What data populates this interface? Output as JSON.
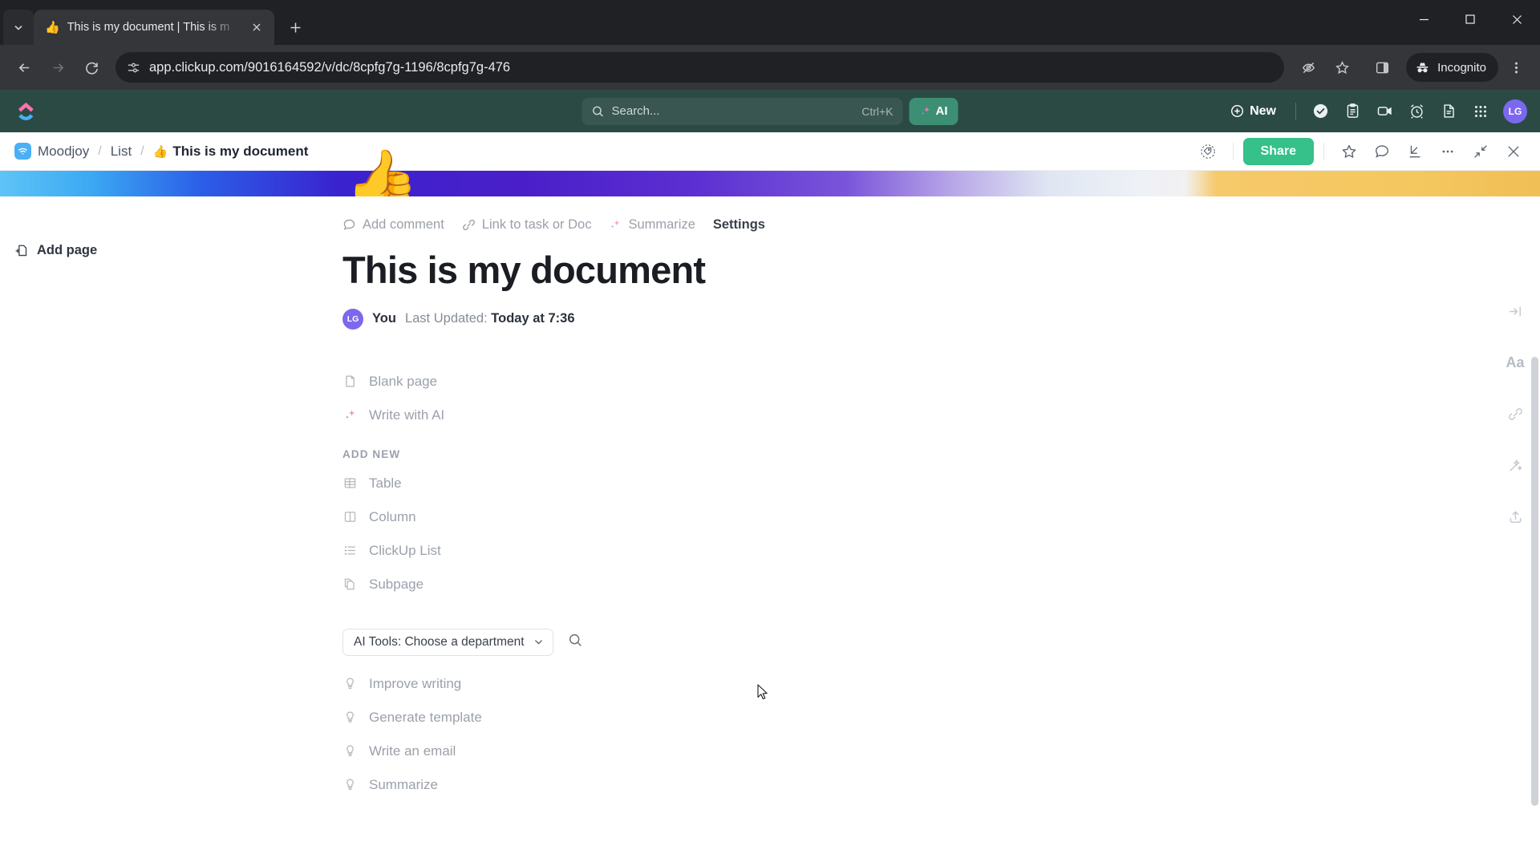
{
  "browser": {
    "tab": {
      "favicon": "thumbs-up-emoji",
      "title": "This is my document | This is m",
      "close_label": "×"
    },
    "new_tab_label": "+",
    "window_controls": {
      "minimize": "—",
      "maximize": "□",
      "close": "✕"
    },
    "nav": {
      "back": "back-arrow",
      "forward": "forward-arrow",
      "reload": "reload-arrow"
    },
    "omnibox": {
      "site_info_icon": "page-settings-icon",
      "url": "app.clickup.com/9016164592/v/dc/8cpfg7g-1196/8cpfg7g-476"
    },
    "toolbar_right": {
      "hide_icon": "eye-off-icon",
      "bookmark_icon": "star-icon",
      "sidepanel_icon": "side-panel-icon",
      "incognito_label": "Incognito",
      "menu_icon": "kebab-menu-icon"
    }
  },
  "app_header": {
    "logo": "clickup-logo",
    "search": {
      "icon": "search-icon",
      "placeholder": "Search...",
      "shortcut": "Ctrl+K"
    },
    "ai_button": {
      "label": "AI",
      "icon": "sparkle-icon",
      "color": "#3d8f74"
    },
    "new_button": {
      "label": "New",
      "icon": "plus-circle-icon"
    },
    "icons": [
      {
        "name": "check-circle-icon",
        "label": "Tasks"
      },
      {
        "name": "clipboard-icon",
        "label": "Notepad"
      },
      {
        "name": "video-camera-icon",
        "label": "Clip"
      },
      {
        "name": "alarm-clock-icon",
        "label": "Reminders"
      },
      {
        "name": "document-icon",
        "label": "Docs"
      },
      {
        "name": "apps-grid-icon",
        "label": "Apps"
      }
    ],
    "avatar": {
      "initials": "LG",
      "color": "#7b68ee"
    },
    "background": "#2b4a44"
  },
  "breadcrumb": {
    "space_icon": "wifi-space-icon",
    "space_color": "#4ab0f5",
    "items": [
      {
        "label": "Moodjoy",
        "current": false
      },
      {
        "label": "List",
        "current": false
      }
    ],
    "separator": "/",
    "current": {
      "emoji": "👍",
      "label": "This is my document"
    },
    "actions": {
      "tag_icon": "tag-icon",
      "share_label": "Share",
      "share_color": "#36c08a",
      "star_icon": "star-icon",
      "comment_icon": "comment-icon",
      "download_icon": "download-arrow-icon",
      "more_icon": "ellipsis-icon",
      "collapse_icon": "collapse-arrows-icon",
      "close_icon": "close-x-icon"
    }
  },
  "doc": {
    "banner_emoji": "👍",
    "actions": [
      {
        "label": "Add comment",
        "icon": "comment-icon",
        "muted": true
      },
      {
        "label": "Link to task or Doc",
        "icon": "link-icon",
        "muted": true
      },
      {
        "label": "Summarize",
        "icon": "sparkle-icon",
        "muted": true
      },
      {
        "label": "Settings",
        "icon": "",
        "muted": false
      }
    ],
    "title": "This is my document",
    "meta": {
      "avatar_initials": "LG",
      "author": "You",
      "updated_prefix": "Last Updated: ",
      "updated_value": "Today at 7:36"
    },
    "quick_options": [
      {
        "label": "Blank page",
        "icon": "page-icon"
      },
      {
        "label": "Write with AI",
        "icon": "sparkle-icon"
      }
    ],
    "add_new_label": "ADD NEW",
    "add_new_items": [
      {
        "label": "Table",
        "icon": "table-icon"
      },
      {
        "label": "Column",
        "icon": "column-icon"
      },
      {
        "label": "ClickUp List",
        "icon": "list-icon"
      },
      {
        "label": "Subpage",
        "icon": "subpage-icon"
      }
    ],
    "ai_tools": {
      "select_label": "AI Tools: Choose a department",
      "chevron": "chevron-down-icon",
      "search_icon": "search-icon",
      "items": [
        {
          "label": "Improve writing",
          "icon": "lightbulb-icon"
        },
        {
          "label": "Generate template",
          "icon": "lightbulb-icon"
        },
        {
          "label": "Write an email",
          "icon": "lightbulb-icon"
        },
        {
          "label": "Summarize",
          "icon": "lightbulb-icon"
        }
      ]
    }
  },
  "left_sidebar": {
    "add_page_label": "Add page",
    "add_page_icon": "add-page-icon"
  },
  "right_rail": [
    {
      "name": "collapse-panel-icon"
    },
    {
      "name": "font-size-icon",
      "label": "Aa"
    },
    {
      "name": "link-icon"
    },
    {
      "name": "magic-wand-icon"
    },
    {
      "name": "share-export-icon"
    }
  ]
}
